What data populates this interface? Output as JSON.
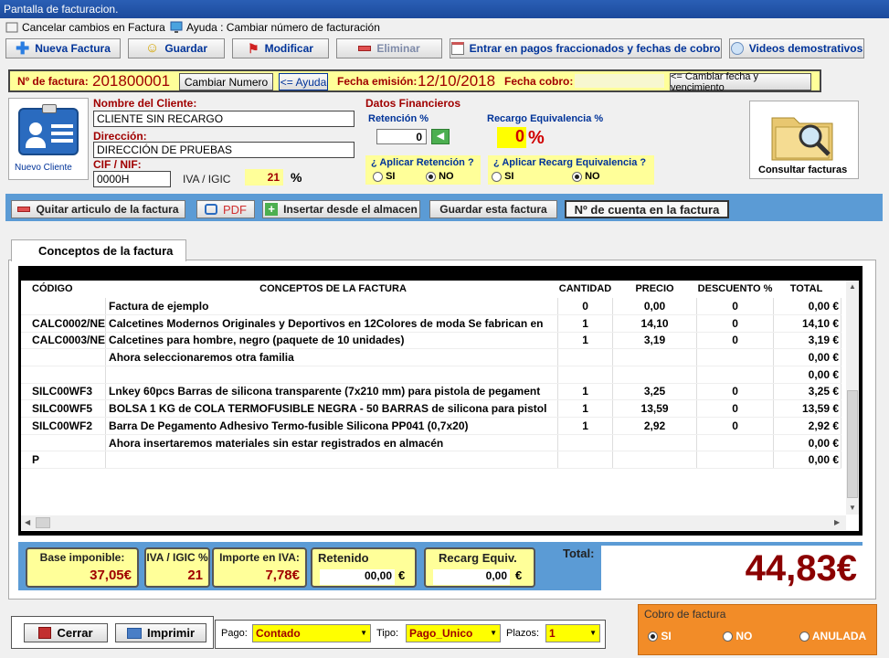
{
  "window": {
    "title": "Pantalla de facturacion."
  },
  "menu": {
    "cancel": "Cancelar cambios en Factura",
    "help": "Ayuda : Cambiar número de facturación"
  },
  "toolbar": {
    "new_invoice": "Nueva Factura",
    "save": "Guardar",
    "modify": "Modificar",
    "delete": "Eliminar",
    "installments": "Entrar en pagos fraccionados y fechas de cobro",
    "videos": "Videos demostrativos"
  },
  "invoice": {
    "number_label": "Nº de factura:",
    "number": "201800001",
    "change_number": "Cambiar Numero",
    "help_btn": "<= Ayuda",
    "issue_date_label": "Fecha emisión:",
    "issue_date": "12/10/2018",
    "collect_date_label": "Fecha cobro:",
    "collect_date": "",
    "change_date_btn": "<= Cambiar fecha y vencimiento"
  },
  "client": {
    "new_client": "Nuevo Cliente",
    "name_label": "Nombre del Cliente:",
    "name": "CLIENTE SIN RECARGO",
    "address_label": "Dirección:",
    "address": "DIRECCIÓN DE PRUEBAS",
    "cif_label": "CIF / NIF:",
    "cif": "0000H",
    "vat_label": "IVA / IGIC",
    "vat": "21",
    "pct": "%"
  },
  "financial": {
    "title": "Datos Financieros",
    "retention_label": "Retención  %",
    "retention": "0",
    "surcharge_label": "Recargo Equivalencia  %",
    "surcharge": "0",
    "surcharge_pct": "%",
    "apply_retention": "¿ Aplicar Retención ?",
    "apply_surcharge": "¿ Aplicar Recarg Equivalencia ?",
    "yes": "SI",
    "no": "NO"
  },
  "search": {
    "label": "Consultar facturas"
  },
  "actions": {
    "remove": "Quitar articulo de la factura",
    "pdf": "PDF",
    "insert": "Insertar desde el almacen",
    "save_invoice": "Guardar esta factura",
    "account": "Nº de cuenta en la factura"
  },
  "tab": {
    "label": "Conceptos de la factura"
  },
  "table": {
    "headers": [
      "CÓDIGO",
      "CONCEPTOS DE LA FACTURA",
      "CANTIDAD",
      "PRECIO",
      "DESCUENTO %",
      "TOTAL"
    ],
    "rows": [
      [
        "",
        "Factura de ejemplo",
        "0",
        "0,00",
        "0",
        "0,00 €"
      ],
      [
        "CALC0002/NE",
        "Calcetines Modernos Originales y Deportivos en 12Colores de moda Se fabrican en",
        "1",
        "14,10",
        "0",
        "14,10 €"
      ],
      [
        "CALC0003/NE",
        "Calcetines para hombre, negro (paquete de 10 unidades)",
        "1",
        "3,19",
        "0",
        "3,19 €"
      ],
      [
        "",
        "Ahora seleccionaremos otra familia",
        "",
        "",
        "",
        "0,00 €"
      ],
      [
        "",
        "",
        "",
        "",
        "",
        "0,00 €"
      ],
      [
        "SILC00WF3",
        "Lnkey 60pcs Barras de silicona transparente (7x210 mm) para pistola de pegament",
        "1",
        "3,25",
        "0",
        "3,25 €"
      ],
      [
        "SILC00WF5",
        "BOLSA 1 KG de COLA TERMOFUSIBLE NEGRA - 50 BARRAS de silicona para pistol",
        "1",
        "13,59",
        "0",
        "13,59 €"
      ],
      [
        "SILC00WF2",
        "Barra De Pegamento Adhesivo Termo-fusible Silicona PP041 (0,7x20)",
        "1",
        "2,92",
        "0",
        "2,92 €"
      ],
      [
        "",
        "Ahora insertaremos materiales sin estar registrados en almacén",
        "",
        "",
        "",
        "0,00 €"
      ],
      [
        "P",
        "",
        "",
        "",
        "",
        "0,00 €"
      ]
    ]
  },
  "summary": {
    "base_label": "Base imponible:",
    "base": "37,05€",
    "vat_label": "IVA / IGIC %",
    "vat": "21",
    "vat_amount_label": "Importe en  IVA:",
    "vat_amount": "7,78€",
    "retained_label": "Retenido",
    "retained": "00,00",
    "surcharge_label": "Recarg Equiv.",
    "surcharge": "0,00",
    "euro": "€",
    "total_label": "Total:",
    "total": "44,83€"
  },
  "bottom": {
    "close": "Cerrar",
    "print": "Imprimir",
    "payment_label": "Pago:",
    "payment": "Contado",
    "type_label": "Tipo:",
    "type": "Pago_Unico",
    "terms_label": "Plazos:",
    "terms": "1",
    "collect_title": "Cobro de factura",
    "collect_yes": "SI",
    "collect_no": "NO",
    "collect_void": "ANULADA"
  }
}
